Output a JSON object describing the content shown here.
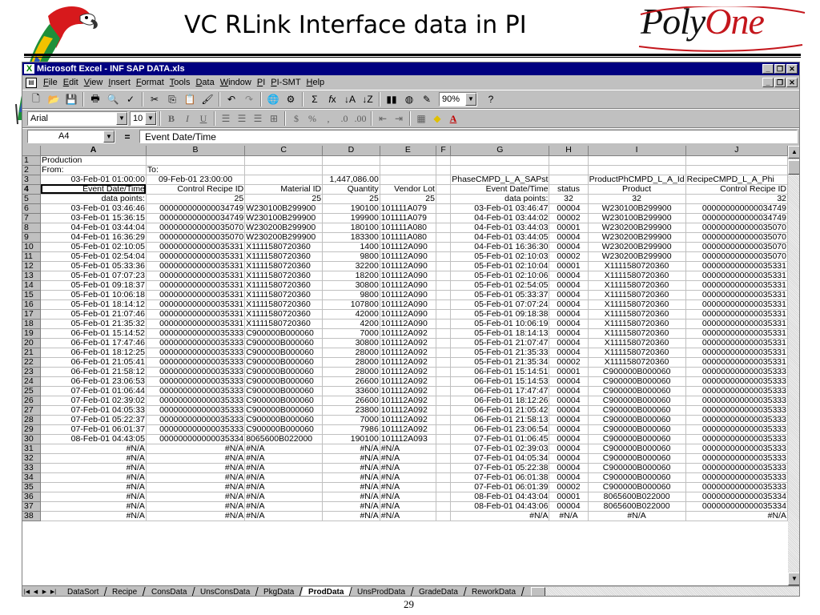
{
  "slide": {
    "title": "VC RLink Interface data in PI",
    "logo_part1": "Poly",
    "logo_part2": "One",
    "page_number": "29"
  },
  "window": {
    "title": "Microsoft Excel - INF SAP DATA.xls",
    "menu": [
      "File",
      "Edit",
      "View",
      "Insert",
      "Format",
      "Tools",
      "Data",
      "Window",
      "PI",
      "PI-SMT",
      "Help"
    ]
  },
  "toolbar": {
    "zoom": "90%",
    "font": "Arial",
    "font_size": "10"
  },
  "formula_bar": {
    "cell_ref": "A4",
    "content": "Event Date/Time"
  },
  "sheet": {
    "columns": [
      "A",
      "B",
      "C",
      "D",
      "E",
      "F",
      "G",
      "H",
      "I",
      "J"
    ],
    "rows": [
      [
        "Production",
        "",
        "",
        "",
        "",
        "",
        "",
        "",
        "",
        ""
      ],
      [
        "From:",
        "To:",
        "",
        "",
        "",
        "",
        "",
        "",
        "",
        ""
      ],
      [
        "03-Feb-01 01:00:00",
        "09-Feb-01 23:00:00",
        "",
        "1,447,086.00",
        "",
        "",
        "PhaseCMPD_L_A_SAPst",
        "",
        "ProductPhCMPD_L_A_Id",
        "RecipeCMPD_L_A_Phi"
      ],
      [
        "Event Date/Time",
        "Control Recipe ID",
        "Material ID",
        "Quantity",
        "Vendor Lot",
        "",
        "Event Date/Time",
        "status",
        "Product",
        "Control Recipe ID"
      ],
      [
        "data points:",
        "25",
        "25",
        "25",
        "25",
        "",
        "data points:",
        "32",
        "32",
        "32"
      ],
      [
        "03-Feb-01 03:46:46",
        "000000000000034749",
        "W230100B299900",
        "190100",
        "101111A079",
        "",
        "03-Feb-01 03:46:47",
        "00004",
        "W230100B299900",
        "000000000000034749"
      ],
      [
        "03-Feb-01 15:36:15",
        "000000000000034749",
        "W230100B299900",
        "199900",
        "101111A079",
        "",
        "04-Feb-01 03:44:02",
        "00002",
        "W230100B299900",
        "000000000000034749"
      ],
      [
        "04-Feb-01 03:44:04",
        "000000000000035070",
        "W230200B299900",
        "180100",
        "101111A080",
        "",
        "04-Feb-01 03:44:03",
        "00001",
        "W230200B299900",
        "000000000000035070"
      ],
      [
        "04-Feb-01 16:36:29",
        "000000000000035070",
        "W230200B299900",
        "183300",
        "101111A080",
        "",
        "04-Feb-01 03:44:05",
        "00004",
        "W230200B299900",
        "000000000000035070"
      ],
      [
        "05-Feb-01 02:10:05",
        "000000000000035331",
        "X1111580720360",
        "1400",
        "101112A090",
        "",
        "04-Feb-01 16:36:30",
        "00004",
        "W230200B299900",
        "000000000000035070"
      ],
      [
        "05-Feb-01 02:54:04",
        "000000000000035331",
        "X1111580720360",
        "9800",
        "101112A090",
        "",
        "05-Feb-01 02:10:03",
        "00002",
        "W230200B299900",
        "000000000000035070"
      ],
      [
        "05-Feb-01 05:33:36",
        "000000000000035331",
        "X1111580720360",
        "32200",
        "101112A090",
        "",
        "05-Feb-01 02:10:04",
        "00001",
        "X1111580720360",
        "000000000000035331"
      ],
      [
        "05-Feb-01 07:07:23",
        "000000000000035331",
        "X1111580720360",
        "18200",
        "101112A090",
        "",
        "05-Feb-01 02:10:06",
        "00004",
        "X1111580720360",
        "000000000000035331"
      ],
      [
        "05-Feb-01 09:18:37",
        "000000000000035331",
        "X1111580720360",
        "30800",
        "101112A090",
        "",
        "05-Feb-01 02:54:05",
        "00004",
        "X1111580720360",
        "000000000000035331"
      ],
      [
        "05-Feb-01 10:06:18",
        "000000000000035331",
        "X1111580720360",
        "9800",
        "101112A090",
        "",
        "05-Feb-01 05:33:37",
        "00004",
        "X1111580720360",
        "000000000000035331"
      ],
      [
        "05-Feb-01 18:14:12",
        "000000000000035331",
        "X1111580720360",
        "107800",
        "101112A090",
        "",
        "05-Feb-01 07:07:24",
        "00004",
        "X1111580720360",
        "000000000000035331"
      ],
      [
        "05-Feb-01 21:07:46",
        "000000000000035331",
        "X1111580720360",
        "42000",
        "101112A090",
        "",
        "05-Feb-01 09:18:38",
        "00004",
        "X1111580720360",
        "000000000000035331"
      ],
      [
        "05-Feb-01 21:35:32",
        "000000000000035331",
        "X1111580720360",
        "4200",
        "101112A090",
        "",
        "05-Feb-01 10:06:19",
        "00004",
        "X1111580720360",
        "000000000000035331"
      ],
      [
        "06-Feb-01 15:14:52",
        "000000000000035333",
        "C900000B000060",
        "7000",
        "101112A092",
        "",
        "05-Feb-01 18:14:13",
        "00004",
        "X1111580720360",
        "000000000000035331"
      ],
      [
        "06-Feb-01 17:47:46",
        "000000000000035333",
        "C900000B000060",
        "30800",
        "101112A092",
        "",
        "05-Feb-01 21:07:47",
        "00004",
        "X1111580720360",
        "000000000000035331"
      ],
      [
        "06-Feb-01 18:12:25",
        "000000000000035333",
        "C900000B000060",
        "28000",
        "101112A092",
        "",
        "05-Feb-01 21:35:33",
        "00004",
        "X1111580720360",
        "000000000000035331"
      ],
      [
        "06-Feb-01 21:05:41",
        "000000000000035333",
        "C900000B000060",
        "28000",
        "101112A092",
        "",
        "05-Feb-01 21:35:34",
        "00002",
        "X1111580720360",
        "000000000000035331"
      ],
      [
        "06-Feb-01 21:58:12",
        "000000000000035333",
        "C900000B000060",
        "28000",
        "101112A092",
        "",
        "06-Feb-01 15:14:51",
        "00001",
        "C900000B000060",
        "000000000000035333"
      ],
      [
        "06-Feb-01 23:06:53",
        "000000000000035333",
        "C900000B000060",
        "26600",
        "101112A092",
        "",
        "06-Feb-01 15:14:53",
        "00004",
        "C900000B000060",
        "000000000000035333"
      ],
      [
        "07-Feb-01 01:06:44",
        "000000000000035333",
        "C900000B000060",
        "33600",
        "101112A092",
        "",
        "06-Feb-01 17:47:47",
        "00004",
        "C900000B000060",
        "000000000000035333"
      ],
      [
        "07-Feb-01 02:39:02",
        "000000000000035333",
        "C900000B000060",
        "26600",
        "101112A092",
        "",
        "06-Feb-01 18:12:26",
        "00004",
        "C900000B000060",
        "000000000000035333"
      ],
      [
        "07-Feb-01 04:05:33",
        "000000000000035333",
        "C900000B000060",
        "23800",
        "101112A092",
        "",
        "06-Feb-01 21:05:42",
        "00004",
        "C900000B000060",
        "000000000000035333"
      ],
      [
        "07-Feb-01 05:22:37",
        "000000000000035333",
        "C900000B000060",
        "7000",
        "101112A092",
        "",
        "06-Feb-01 21:58:13",
        "00004",
        "C900000B000060",
        "000000000000035333"
      ],
      [
        "07-Feb-01 06:01:37",
        "000000000000035333",
        "C900000B000060",
        "7986",
        "101112A092",
        "",
        "06-Feb-01 23:06:54",
        "00004",
        "C900000B000060",
        "000000000000035333"
      ],
      [
        "08-Feb-01 04:43:05",
        "000000000000035334",
        "8065600B022000",
        "190100",
        "101112A093",
        "",
        "07-Feb-01 01:06:45",
        "00004",
        "C900000B000060",
        "000000000000035333"
      ],
      [
        "#N/A",
        "#N/A",
        "#N/A",
        "#N/A",
        "#N/A",
        "",
        "07-Feb-01 02:39:03",
        "00004",
        "C900000B000060",
        "000000000000035333"
      ],
      [
        "#N/A",
        "#N/A",
        "#N/A",
        "#N/A",
        "#N/A",
        "",
        "07-Feb-01 04:05:34",
        "00004",
        "C900000B000060",
        "000000000000035333"
      ],
      [
        "#N/A",
        "#N/A",
        "#N/A",
        "#N/A",
        "#N/A",
        "",
        "07-Feb-01 05:22:38",
        "00004",
        "C900000B000060",
        "000000000000035333"
      ],
      [
        "#N/A",
        "#N/A",
        "#N/A",
        "#N/A",
        "#N/A",
        "",
        "07-Feb-01 06:01:38",
        "00004",
        "C900000B000060",
        "000000000000035333"
      ],
      [
        "#N/A",
        "#N/A",
        "#N/A",
        "#N/A",
        "#N/A",
        "",
        "07-Feb-01 06:01:39",
        "00002",
        "C900000B000060",
        "000000000000035333"
      ],
      [
        "#N/A",
        "#N/A",
        "#N/A",
        "#N/A",
        "#N/A",
        "",
        "08-Feb-01 04:43:04",
        "00001",
        "8065600B022000",
        "000000000000035334"
      ],
      [
        "#N/A",
        "#N/A",
        "#N/A",
        "#N/A",
        "#N/A",
        "",
        "08-Feb-01 04:43:06",
        "00004",
        "8065600B022000",
        "000000000000035334"
      ],
      [
        "#N/A",
        "#N/A",
        "#N/A",
        "#N/A",
        "#N/A",
        "",
        "#N/A",
        "#N/A",
        "#N/A",
        "#N/A"
      ]
    ],
    "tabs": [
      "DataSort",
      "Recipe",
      "ConsData",
      "UnsConsData",
      "PkgData",
      "ProdData",
      "UnsProdData",
      "GradeData",
      "ReworkData"
    ],
    "active_tab": "ProdData"
  },
  "colors": {
    "titlebar": "#000080",
    "chrome": "#c0c0c0",
    "logo_accent": "#c4161c"
  },
  "icons": {
    "decoration": "parrot-icon",
    "excel": "excel-logo-icon"
  }
}
